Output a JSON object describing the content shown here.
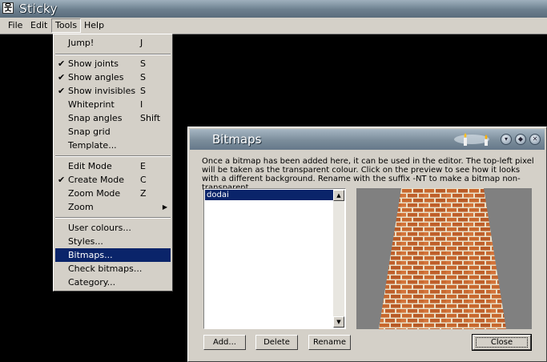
{
  "app": {
    "title": "Sticky",
    "icon": "stick-figure-icon"
  },
  "menubar": [
    {
      "label": "File"
    },
    {
      "label": "Edit"
    },
    {
      "label": "Tools"
    },
    {
      "label": "Help"
    }
  ],
  "tools_menu": {
    "jump": {
      "label": "Jump!",
      "shortcut": "J"
    },
    "show_joints": {
      "label": "Show joints",
      "shortcut": "S",
      "checked": true
    },
    "show_angles": {
      "label": "Show angles",
      "shortcut": "S",
      "checked": true
    },
    "show_invisibles": {
      "label": "Show invisibles",
      "shortcut": "S",
      "checked": true
    },
    "whiteprint": {
      "label": "Whiteprint",
      "shortcut": "I"
    },
    "snap_angles": {
      "label": "Snap angles",
      "shortcut": "Shift"
    },
    "snap_grid": {
      "label": "Snap grid"
    },
    "template": {
      "label": "Template..."
    },
    "edit_mode": {
      "label": "Edit Mode",
      "shortcut": "E"
    },
    "create_mode": {
      "label": "Create Mode",
      "shortcut": "C",
      "checked": true
    },
    "zoom_mode": {
      "label": "Zoom Mode",
      "shortcut": "Z"
    },
    "zoom": {
      "label": "Zoom"
    },
    "user_colours": {
      "label": "User colours..."
    },
    "styles": {
      "label": "Styles..."
    },
    "bitmaps": {
      "label": "Bitmaps...",
      "highlighted": true
    },
    "check_bitmaps": {
      "label": "Check bitmaps..."
    },
    "category": {
      "label": "Category..."
    }
  },
  "bitmaps_dialog": {
    "title": "Bitmaps",
    "description": "Once a bitmap has been added here, it can be used in the editor. The top-left pixel will be taken as the transparent colour. Click on the preview to see how it looks with a different background. Rename with the suffix -NT to make a bitmap non-transparent.",
    "items": [
      "dodai"
    ],
    "buttons": {
      "add": "Add...",
      "delete": "Delete",
      "rename": "Rename",
      "close": "Close"
    }
  },
  "colors": {
    "selection": "#0a246a",
    "face": "#d4d0c8",
    "brick": "#c8682e",
    "mortar": "#eadfc7"
  }
}
